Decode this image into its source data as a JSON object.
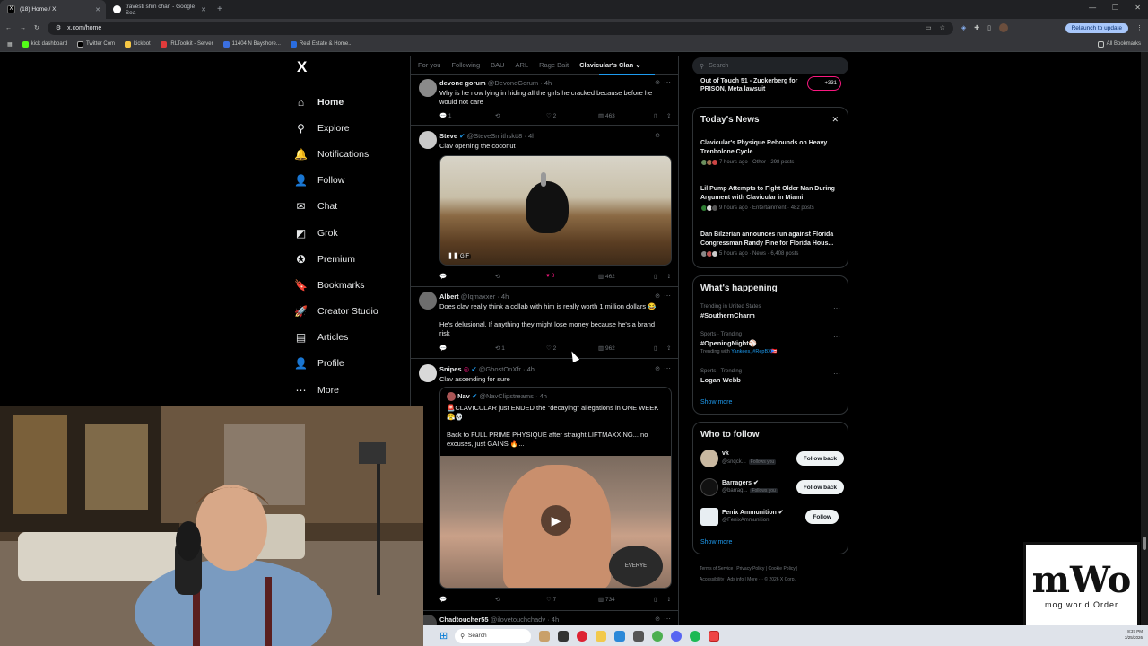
{
  "browser": {
    "tabs": [
      {
        "label": "(18) Home / X",
        "active": true
      },
      {
        "label": "travesti shin chan - Google Sea",
        "active": false
      }
    ],
    "url": "x.com/home",
    "relaunch_label": "Relaunch to update",
    "bookmarks": [
      "kick dashboard",
      "Twitter Com",
      "kickbot",
      "IRLToolkit - Server",
      "11404 N Bayshore...",
      "Real Estate & Home..."
    ],
    "all_bookmarks_label": "All Bookmarks"
  },
  "nav": {
    "logo": "X",
    "items": [
      {
        "label": "Home",
        "icon": "home-icon",
        "glyph": "⌂"
      },
      {
        "label": "Explore",
        "icon": "search-icon",
        "glyph": "⚲"
      },
      {
        "label": "Notifications",
        "icon": "bell-icon",
        "glyph": "🔔"
      },
      {
        "label": "Follow",
        "icon": "follow-icon",
        "glyph": "👤"
      },
      {
        "label": "Chat",
        "icon": "mail-icon",
        "glyph": "✉"
      },
      {
        "label": "Grok",
        "icon": "grok-icon",
        "glyph": "◩"
      },
      {
        "label": "Premium",
        "icon": "premium-icon",
        "glyph": "✪"
      },
      {
        "label": "Bookmarks",
        "icon": "bookmark-icon",
        "glyph": "🔖"
      },
      {
        "label": "Creator Studio",
        "icon": "rocket-icon",
        "glyph": "🚀"
      },
      {
        "label": "Articles",
        "icon": "articles-icon",
        "glyph": "▤"
      },
      {
        "label": "Profile",
        "icon": "profile-icon",
        "glyph": "👤"
      },
      {
        "label": "More",
        "icon": "more-icon",
        "glyph": "⋯"
      }
    ]
  },
  "feed": {
    "tabs": [
      "For you",
      "Following",
      "BAU",
      "ARL",
      "Rage Bait",
      "Clavicular's Clan"
    ],
    "posts": [
      {
        "name": "devone gorum",
        "handle": "@DevoneGorum",
        "time": "· 4h",
        "text": "Why is he now lying in hiding all the girls he cracked because before he would not care",
        "reply": "1",
        "repost": "",
        "like": "2",
        "views": "463"
      },
      {
        "name": "Steve",
        "handle": "@SteveSmithsktt8",
        "time": "· 4h",
        "text": "Clav opening the coconut",
        "media_label": "GIF",
        "reply": "",
        "repost": "",
        "like": "8",
        "views": "462"
      },
      {
        "name": "Albert",
        "handle": "@Iqmaxxer",
        "time": "· 4h",
        "text": "Does clav really think a collab with him is really worth 1 million dollars 😂",
        "text2": "He's delusional. If anything they might lose money because he's a brand risk",
        "reply": "",
        "repost": "1",
        "like": "2",
        "views": "962"
      },
      {
        "name": "Snipes",
        "handle": "@GhostOnXfr",
        "time": "· 4h",
        "text": "Clav ascending for sure",
        "quote_name": "Nav",
        "quote_handle": "@NavClipstreams",
        "quote_time": "· 4h",
        "quote_text": "🚨CLAVICULAR just ENDED the \"decaying\" allegations in ONE WEEK 😤💀",
        "quote_text2": "Back to FULL PRIME PHYSIQUE after straight LIFTMAXXING... no excuses, just GAINS 🔥...",
        "media_watermark": "EVERYE",
        "reply": "",
        "repost": "",
        "like": "7",
        "views": "734"
      },
      {
        "name": "Chadtoucher55",
        "handle": "@ilovetouchchadv",
        "time": "· 4h"
      }
    ]
  },
  "right": {
    "search_placeholder": "Search",
    "top_story": "Out of Touch 51 - Zuckerberg for PRISON, Meta lawsuit",
    "top_story_count": "+331",
    "todays_news": {
      "title": "Today's News",
      "items": [
        {
          "title": "Clavicular's Physique Rebounds on Heavy Trenbolone Cycle",
          "meta": "7 hours ago · Other · 298 posts"
        },
        {
          "title": "Lil Pump Attempts to Fight Older Man During Argument with Clavicular in Miami",
          "meta": "9 hours ago · Entertainment · 482 posts"
        },
        {
          "title": "Dan Bilzerian announces run against Florida Congressman Randy Fine for Florida Hous...",
          "meta": "5 hours ago · News · 6,408 posts"
        }
      ]
    },
    "whats_happening": {
      "title": "What's happening",
      "items": [
        {
          "context": "Trending in United States",
          "name": "#SouthernCharm",
          "with": ""
        },
        {
          "context": "Sports · Trending",
          "name": "#OpeningNight⚾",
          "with": "Trending with",
          "with_links": "Yankees, #RepBX🇵🇷"
        },
        {
          "context": "Sports · Trending",
          "name": "Logan Webb",
          "with": ""
        }
      ],
      "show_more": "Show more"
    },
    "who_to_follow": {
      "title": "Who to follow",
      "items": [
        {
          "name": "vk",
          "handle": "@snqck...",
          "badge": "Follows you",
          "button": "Follow back"
        },
        {
          "name": "Barragers ✔",
          "handle": "@barrag...",
          "badge": "Follows you",
          "button": "Follow back"
        },
        {
          "name": "Fenix Ammunition ✔",
          "handle": "@FenixAmmunition",
          "badge": "",
          "button": "Follow"
        }
      ],
      "show_more": "Show more"
    },
    "footer_line1": "Terms of Service  |  Privacy Policy  |  Cookie Policy  |",
    "footer_line2": "Accessibility  |  Ads info  |  More ···  © 2026 X Corp."
  },
  "overlay": {
    "logo_text": "mWo",
    "logo_caption": "mog world Order"
  },
  "taskbar": {
    "search_label": "Search",
    "time": "8:37 PM",
    "date": "3/25/2026"
  },
  "colors": {
    "accent": "#1d9bf0",
    "like": "#f91880",
    "bg": "#000000",
    "border": "#2f3336",
    "muted": "#71767b"
  }
}
